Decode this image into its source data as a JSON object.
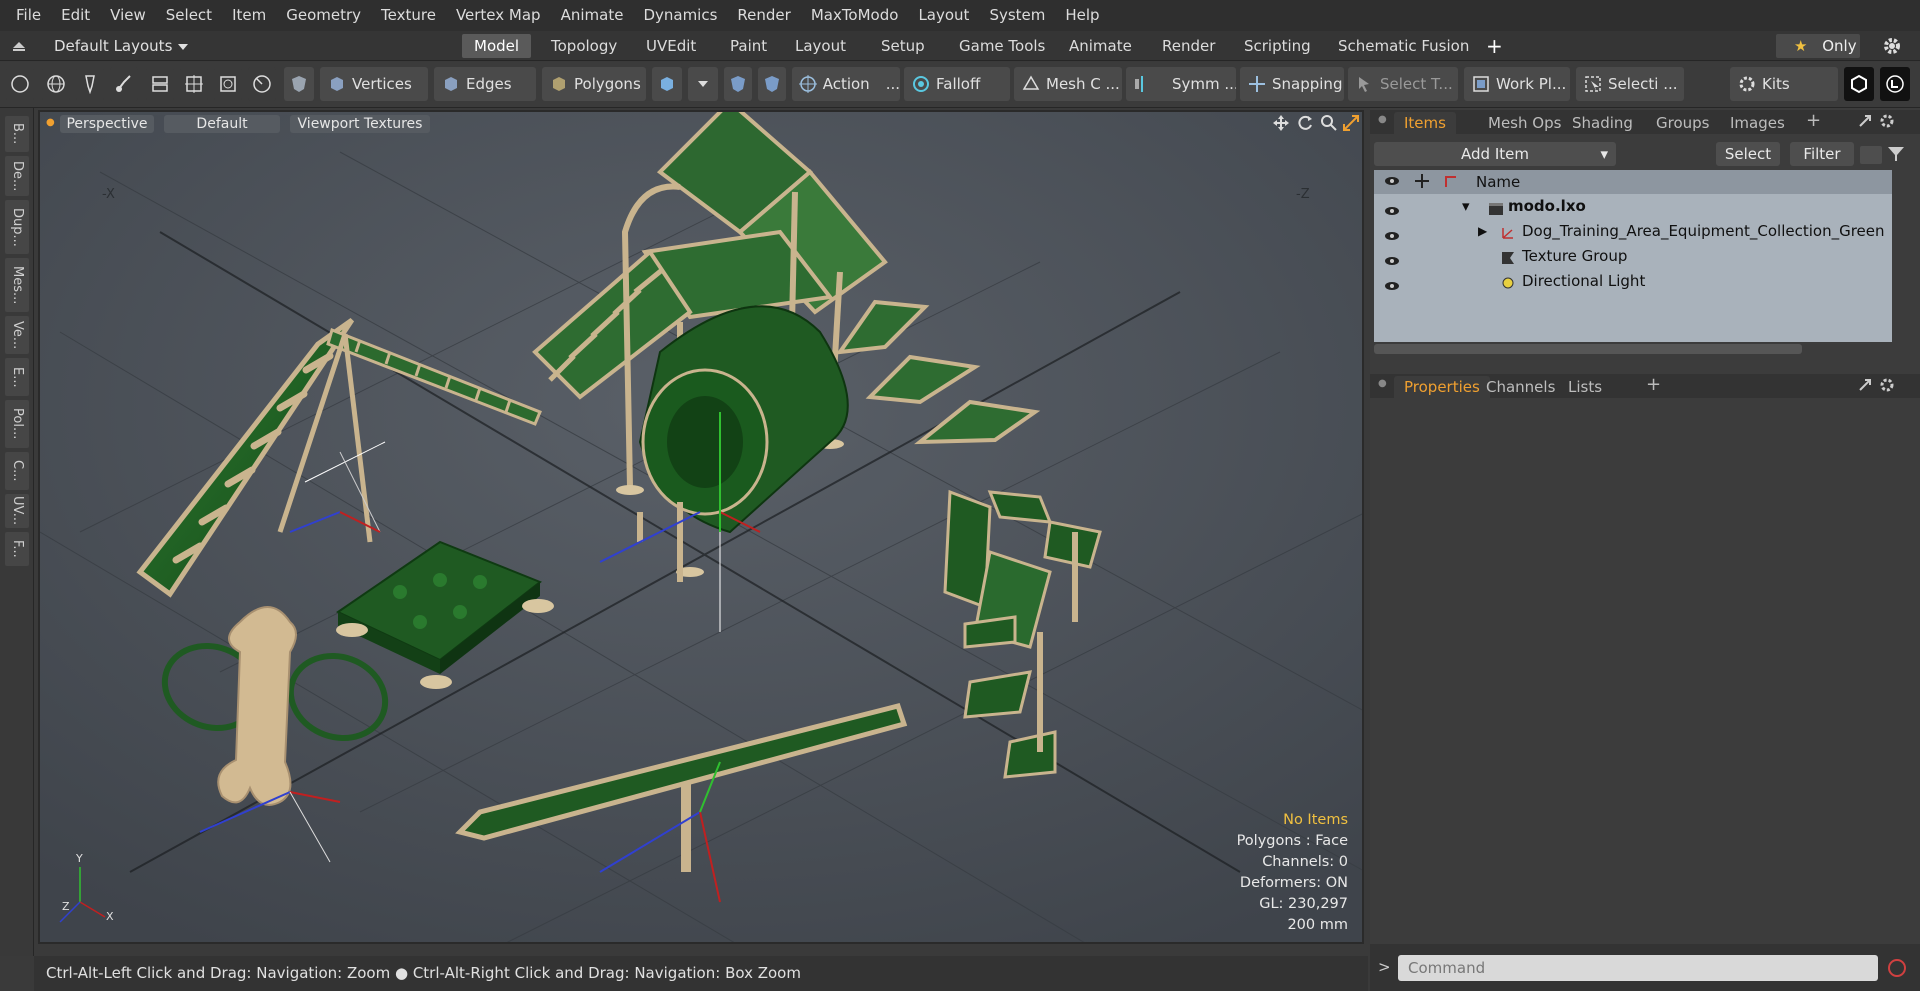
{
  "menu": [
    "File",
    "Edit",
    "View",
    "Select",
    "Item",
    "Geometry",
    "Texture",
    "Vertex Map",
    "Animate",
    "Dynamics",
    "Render",
    "MaxToModo",
    "Layout",
    "System",
    "Help"
  ],
  "layouts": {
    "label": "Default Layouts"
  },
  "mode_tabs": [
    "Model",
    "Topology",
    "UVEdit",
    "Paint",
    "Layout",
    "Setup",
    "Game Tools",
    "Animate",
    "Render",
    "Scripting",
    "Schematic Fusion"
  ],
  "only_label": "Only",
  "toolbar": {
    "vertices": "Vertices",
    "edges": "Edges",
    "polygons": "Polygons",
    "action": "Action",
    "falloff": "Falloff",
    "mesh": "Mesh C ...",
    "symm": "Symm ...",
    "snapping": "Snapping",
    "select_t": "Select T...",
    "workplane": "Work Pl...",
    "selection": "Selecti ...",
    "kits": "Kits"
  },
  "left_tabs": [
    "B...",
    "De...",
    "Dup...",
    "Mes...",
    "Ve...",
    "E...",
    "Pol...",
    "C...",
    "UV...",
    "F..."
  ],
  "viewport": {
    "view": "Perspective",
    "shading": "Default",
    "textures": "Viewport Textures",
    "stats": {
      "no_items": "No Items",
      "polygons": "Polygons : Face",
      "channels": "Channels: 0",
      "deformers": "Deformers: ON",
      "gl": "GL: 230,297",
      "scale": "200 mm"
    }
  },
  "status": "Ctrl-Alt-Left Click and Drag: Navigation: Zoom ● Ctrl-Alt-Right Click and Drag: Navigation: Box Zoom",
  "items_panel": {
    "tabs": [
      "Items",
      "Mesh Ops",
      "Shading",
      "Groups",
      "Images"
    ],
    "add_item": "Add Item",
    "select": "Select",
    "filter": "Filter",
    "name_header": "Name",
    "rows": [
      "modo.lxo",
      "Dog_Training_Area_Equipment_Collection_Green",
      "Texture Group",
      "Directional Light"
    ]
  },
  "props_panel": {
    "tabs": [
      "Properties",
      "Channels",
      "Lists"
    ]
  },
  "command_placeholder": "Command",
  "colors": {
    "accent": "#f0a030",
    "equipment_green": "#1f5a22",
    "frame_tan": "#c9b48e"
  }
}
